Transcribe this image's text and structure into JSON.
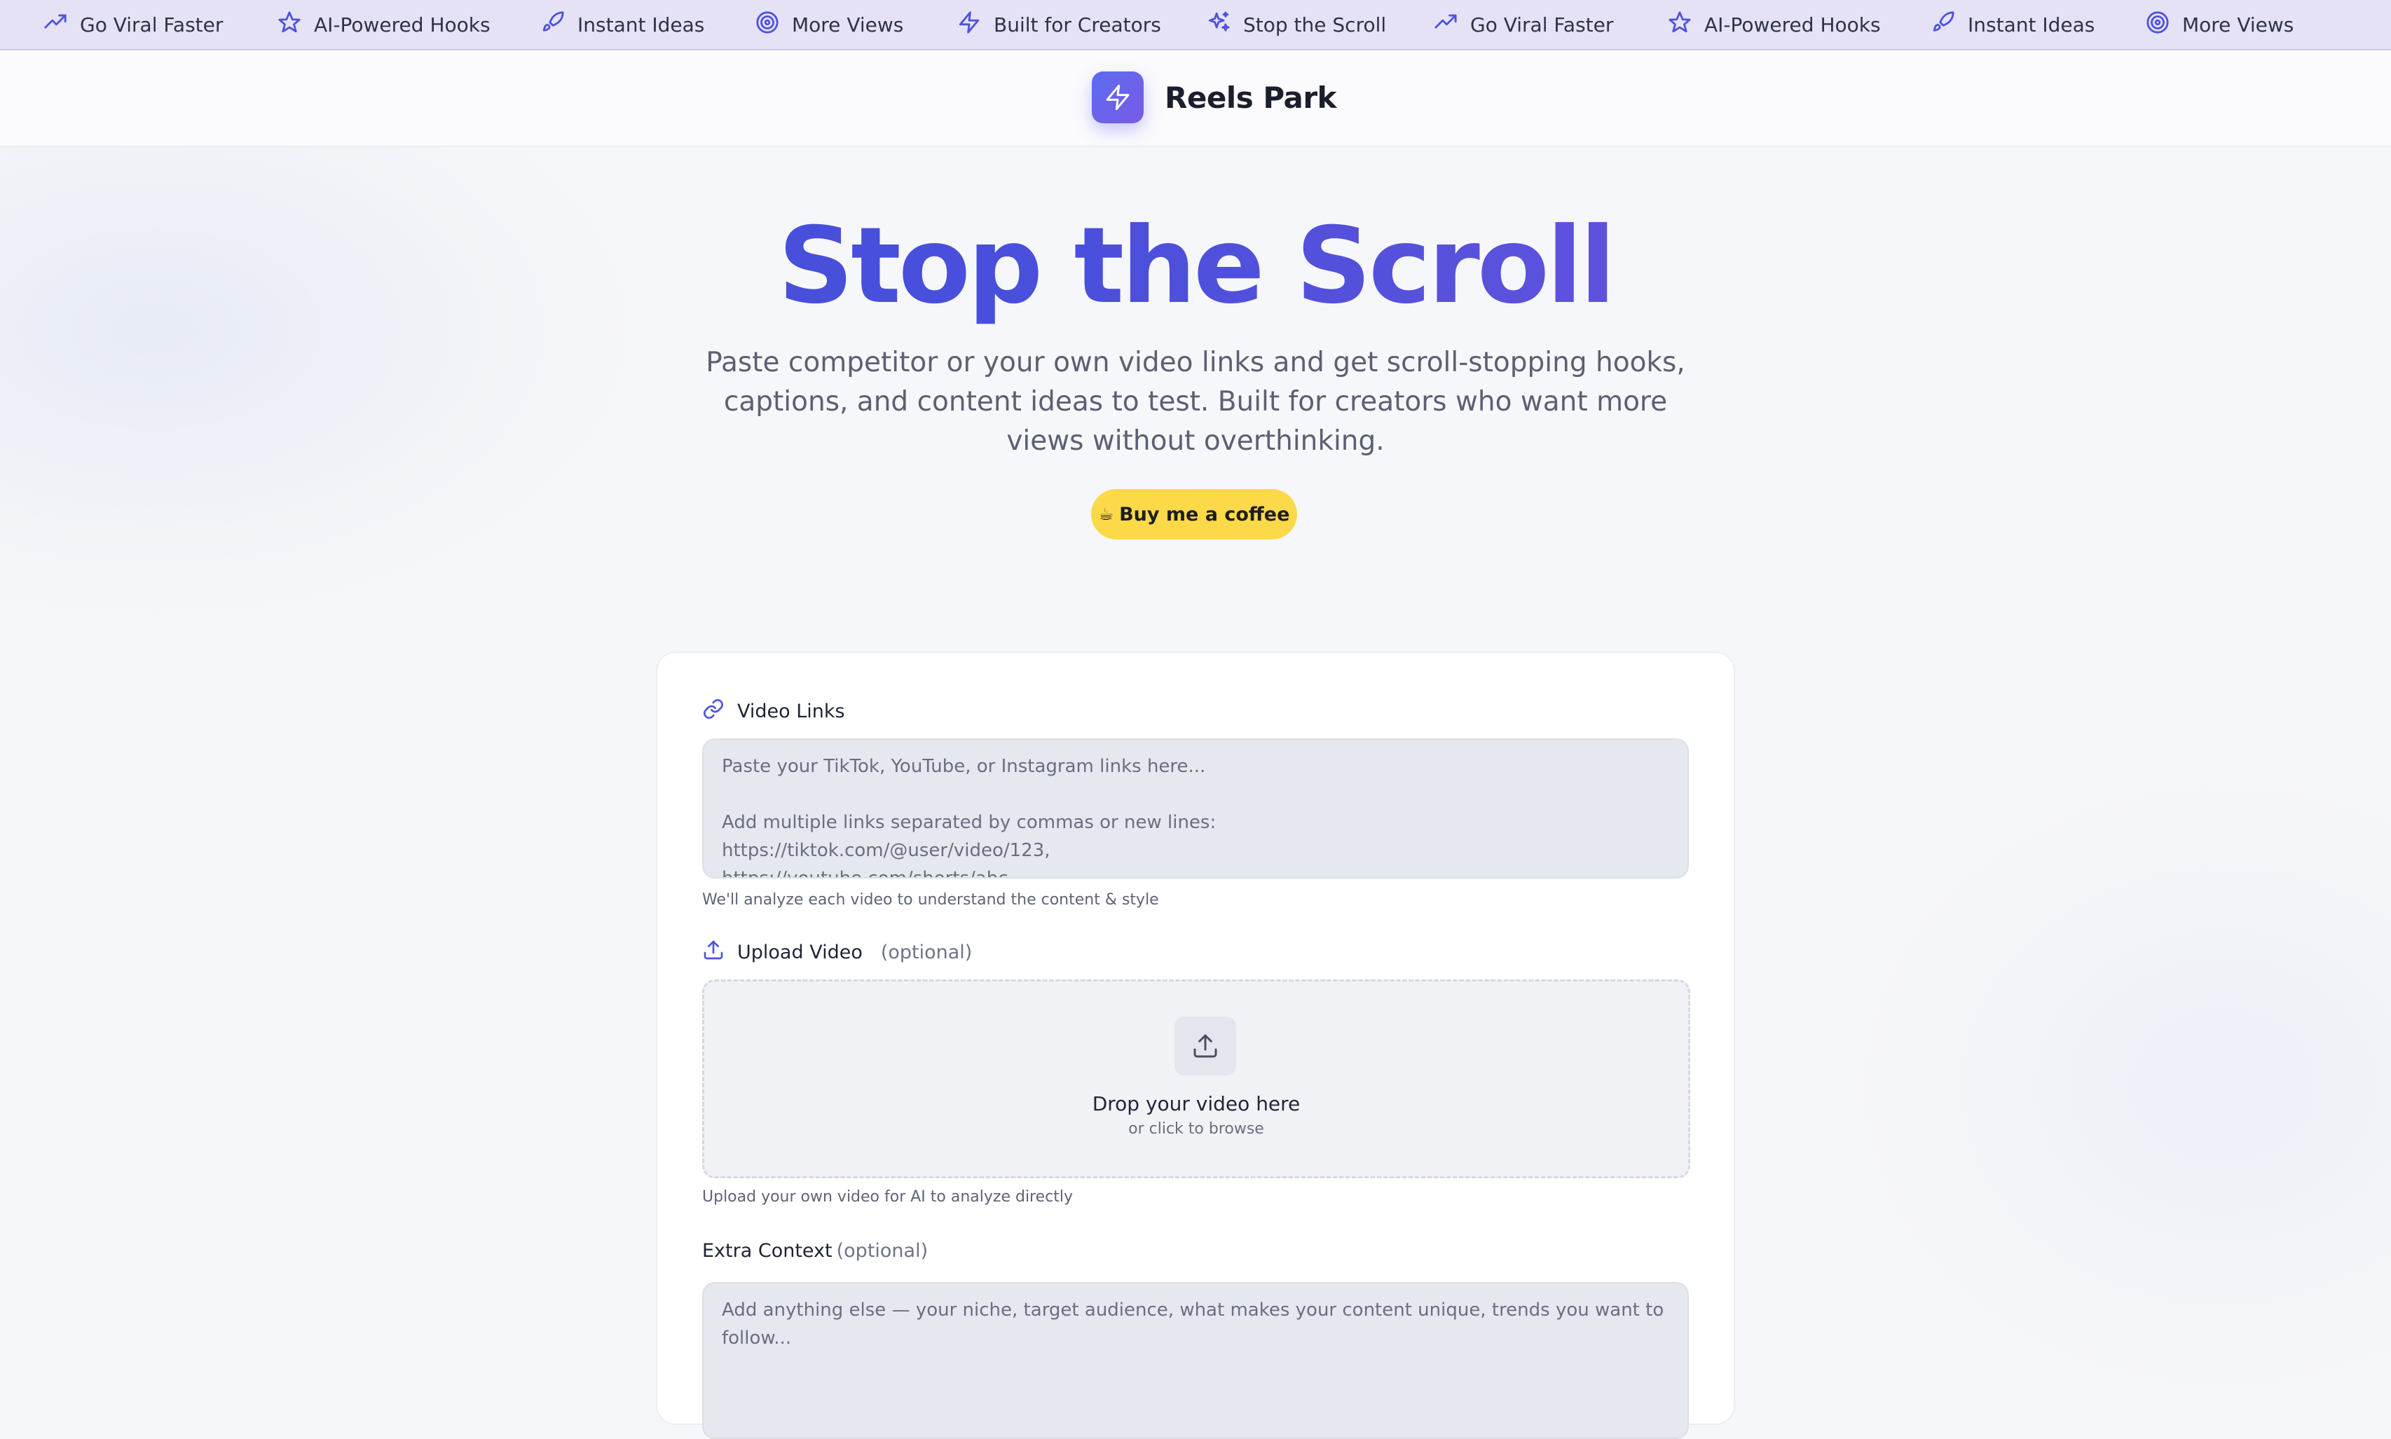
{
  "ticker": {
    "items": [
      {
        "icon": "trending-up-icon",
        "label": "Go Viral Faster"
      },
      {
        "icon": "star-icon",
        "label": "AI-Powered Hooks"
      },
      {
        "icon": "rocket-icon",
        "label": "Instant Ideas"
      },
      {
        "icon": "target-icon",
        "label": "More Views"
      },
      {
        "icon": "zap-icon",
        "label": "Built for Creators"
      },
      {
        "icon": "sparkles-icon",
        "label": "Stop the Scroll"
      },
      {
        "icon": "trending-up-icon",
        "label": "Go Viral Faster"
      },
      {
        "icon": "star-icon",
        "label": "AI-Powered Hooks"
      },
      {
        "icon": "rocket-icon",
        "label": "Instant Ideas"
      },
      {
        "icon": "target-icon",
        "label": "More Views"
      }
    ]
  },
  "header": {
    "logo_icon": "zap-icon",
    "brand": "Reels Park"
  },
  "hero": {
    "title": "Stop the Scroll",
    "subtitle": "Paste competitor or your own video links and get scroll-stopping hooks, captions, and content ideas to test. Built for creators who want more views without overthinking.",
    "coffee_icon": "☕",
    "coffee_label": "Buy me a coffee"
  },
  "form": {
    "video_links": {
      "label": "Video Links",
      "placeholder": "Paste your TikTok, YouTube, or Instagram links here...\n\nAdd multiple links separated by commas or new lines:\nhttps://tiktok.com/@user/video/123,\nhttps://youtube.com/shorts/abc",
      "helper": "We'll analyze each video to understand the content & style"
    },
    "upload": {
      "label": "Upload Video",
      "optional": "(optional)",
      "drop_title": "Drop your video here",
      "drop_sub": "or click to browse",
      "helper": "Upload your own video for AI to analyze directly"
    },
    "extra_context": {
      "label": "Extra Context",
      "optional": "(optional)",
      "placeholder": "Add anything else — your niche, target audience, what makes your content unique, trends you want to follow..."
    }
  },
  "colors": {
    "accent": "#4f46e5",
    "accent_purple": "#7b56de",
    "ticker_bg": "#e5e2f6",
    "coffee_button": "#fcd949"
  }
}
